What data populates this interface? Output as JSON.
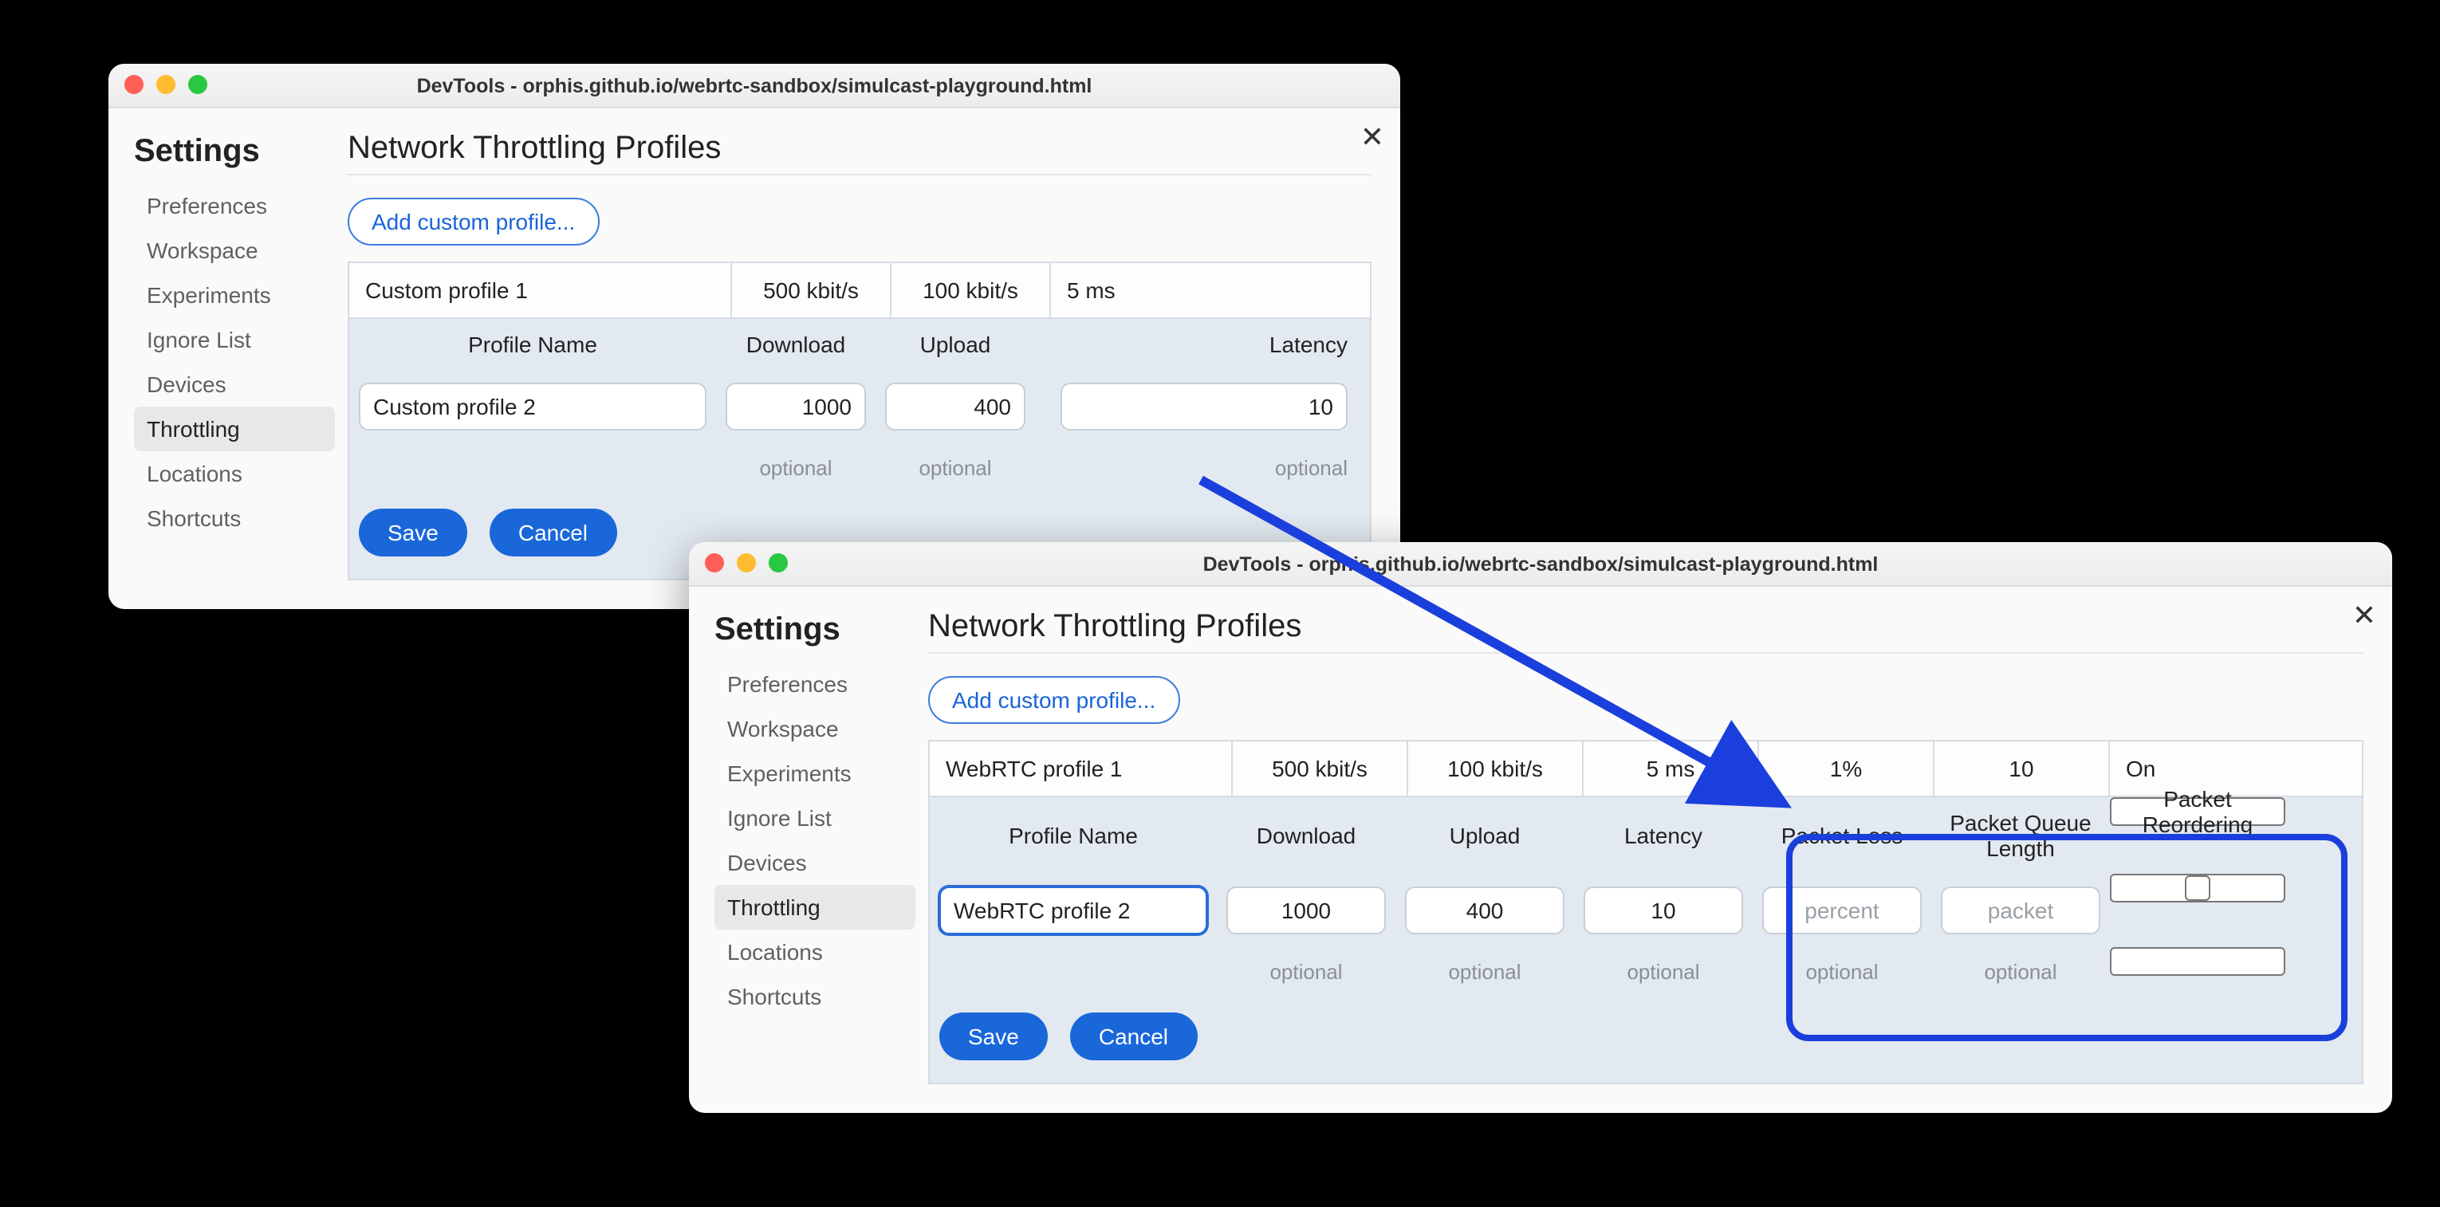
{
  "window_title": "DevTools - orphis.github.io/webrtc-sandbox/simulcast-playground.html",
  "sidebar": {
    "title": "Settings",
    "items": [
      "Preferences",
      "Workspace",
      "Experiments",
      "Ignore List",
      "Devices",
      "Throttling",
      "Locations",
      "Shortcuts"
    ],
    "active_index": 5
  },
  "page": {
    "heading": "Network Throttling Profiles",
    "add_button": "Add custom profile..."
  },
  "panel_a": {
    "existing": {
      "name": "Custom profile 1",
      "download": "500 kbit/s",
      "upload": "100 kbit/s",
      "latency": "5 ms"
    },
    "labels": [
      "Profile Name",
      "Download",
      "Upload",
      "Latency"
    ],
    "edit": {
      "name": "Custom profile 2",
      "download": "1000",
      "upload": "400",
      "latency": "10"
    },
    "optional_label": "optional",
    "save": "Save",
    "cancel": "Cancel"
  },
  "panel_b": {
    "existing": {
      "name": "WebRTC profile 1",
      "download": "500 kbit/s",
      "upload": "100 kbit/s",
      "latency": "5 ms",
      "loss": "1%",
      "queue": "10",
      "reorder": "On"
    },
    "labels": [
      "Profile Name",
      "Download",
      "Upload",
      "Latency",
      "Packet Loss",
      "Packet Queue Length",
      "Packet Reordering"
    ],
    "edit": {
      "name": "WebRTC profile 2",
      "download": "1000",
      "upload": "400",
      "latency": "10"
    },
    "placeholders": {
      "loss": "percent",
      "queue": "packet"
    },
    "optional_label": "optional",
    "save": "Save",
    "cancel": "Cancel"
  }
}
